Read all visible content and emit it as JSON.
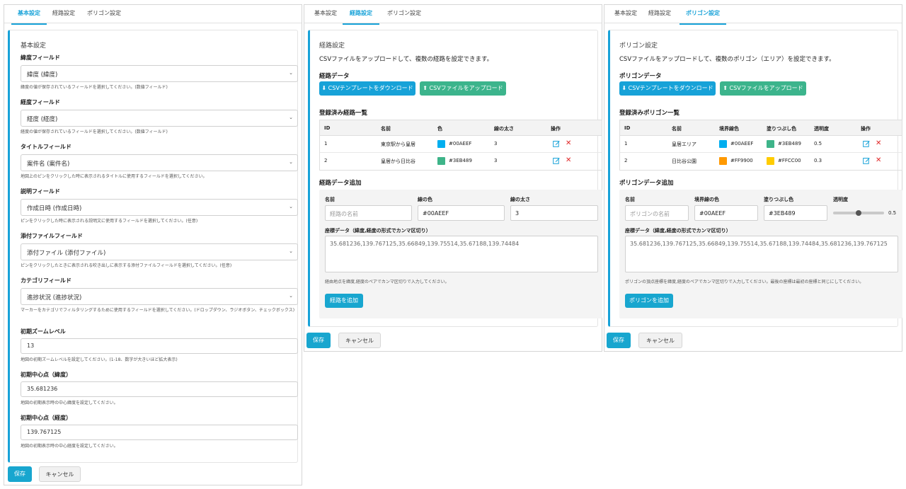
{
  "panel1": {
    "tabs": [
      "基本設定",
      "経路設定",
      "ポリゴン設定"
    ],
    "card_title": "基本設定",
    "fields": [
      {
        "label": "緯度フィールド",
        "value": "緯度 (緯度)",
        "help": "緯度の値が保存されているフィールドを選択してください。(数値フィールド)"
      },
      {
        "label": "経度フィールド",
        "value": "経度 (経度)",
        "help": "経度の値が保存されているフィールドを選択してください。(数値フィールド)"
      },
      {
        "label": "タイトルフィールド",
        "value": "案件名 (案件名)",
        "help": "地図上のピンをクリックした時に表示されるタイトルに使用するフィールドを選択してください。"
      },
      {
        "label": "説明フィールド",
        "value": "作成日時 (作成日時)",
        "help": "ピンをクリックした時に表示される説明文に使用するフィールドを選択してください。(任意)"
      },
      {
        "label": "添付ファイルフィールド",
        "value": "添付ファイル (添付ファイル)",
        "help": "ピンをクリックしたときに表示される吹き出しに表示する添付ファイルフィールドを選択してください。(任意)"
      },
      {
        "label": "カテゴリフィールド",
        "value": "進捗状況 (進捗状況)",
        "help": "マーカーをカテゴリでフィルタリングするために使用するフィールドを選択してください。(ドロップダウン、ラジオボタン、チェックボックス)"
      }
    ],
    "zoom": {
      "label": "初期ズームレベル",
      "value": "13",
      "help": "地図の初期ズームレベルを設定してください。(1-18、数字が大きいほど拡大表示)"
    },
    "center_lat": {
      "label": "初期中心点（緯度）",
      "value": "35.681236",
      "help": "地図の初期表示時の中心緯度を設定してください。"
    },
    "center_lng": {
      "label": "初期中心点（経度）",
      "value": "139.767125",
      "help": "地図の初期表示時の中心経度を設定してください。"
    },
    "save": "保存",
    "cancel": "キャンセル"
  },
  "panel2": {
    "tabs": [
      "基本設定",
      "経路設定",
      "ポリゴン設定"
    ],
    "card_title": "経路設定",
    "description": "CSVファイルをアップロードして、複数の経路を設定できます。",
    "data_section": "経路データ",
    "download_btn": "CSVテンプレートをダウンロード",
    "upload_btn": "CSVファイルをアップロード",
    "list_title": "登録済み経路一覧",
    "columns": [
      "ID",
      "名前",
      "色",
      "線の太さ",
      "操作"
    ],
    "rows": [
      {
        "id": "1",
        "name": "東京駅から皇居",
        "color": "#00AEEF",
        "width": "3"
      },
      {
        "id": "2",
        "name": "皇居から日比谷",
        "color": "#3EB489",
        "width": "3"
      }
    ],
    "add_title": "経路データ追加",
    "form": {
      "name_label": "名前",
      "name_placeholder": "経路の名前",
      "color_label": "線の色",
      "color_value": "#00AEEF",
      "width_label": "線の太さ",
      "width_value": "3",
      "coords_label": "座標データ（緯度,経度の形式でカンマ区切り）",
      "coords_value": "35.681236,139.767125,35.66849,139.75514,35.67188,139.74484",
      "coords_help": "経由地点を緯度,経度のペアでカンマ区切りで入力してください。",
      "add_btn": "経路を追加"
    },
    "save": "保存",
    "cancel": "キャンセル"
  },
  "panel3": {
    "tabs": [
      "基本設定",
      "経路設定",
      "ポリゴン設定"
    ],
    "card_title": "ポリゴン設定",
    "description": "CSVファイルをアップロードして、複数のポリゴン（エリア）を設定できます。",
    "data_section": "ポリゴンデータ",
    "download_btn": "CSVテンプレートをダウンロード",
    "upload_btn": "CSVファイルをアップロード",
    "list_title": "登録済みポリゴン一覧",
    "columns": [
      "ID",
      "名前",
      "境界線色",
      "塗りつぶし色",
      "透明度",
      "操作"
    ],
    "rows": [
      {
        "id": "1",
        "name": "皇居エリア",
        "border": "#00AEEF",
        "fill": "#3EB489",
        "opacity": "0.5"
      },
      {
        "id": "2",
        "name": "日比谷公園",
        "border": "#FF9900",
        "fill": "#FFCC00",
        "opacity": "0.3"
      }
    ],
    "add_title": "ポリゴンデータ追加",
    "form": {
      "name_label": "名前",
      "name_placeholder": "ポリゴンの名前",
      "border_label": "境界線の色",
      "border_value": "#00AEEF",
      "fill_label": "塗りつぶし色",
      "fill_value": "#3EB489",
      "opacity_label": "透明度",
      "opacity_value": "0.5",
      "coords_label": "座標データ（緯度,経度の形式でカンマ区切り）",
      "coords_value": "35.681236,139.767125,35.66849,139.75514,35.67188,139.74484,35.681236,139.767125",
      "coords_help": "ポリゴンの頂点座標を緯度,経度のペアでカンマ区切りで入力してください。最後の座標は最初の座標と同じにしてください。",
      "add_btn": "ポリゴンを追加"
    },
    "save": "保存",
    "cancel": "キャンセル"
  },
  "colors": {
    "accent": "#17a2d8",
    "success": "#3cb48c",
    "danger": "#e02424"
  },
  "icons": {
    "download": "download-icon",
    "upload": "upload-icon",
    "edit": "edit-icon",
    "delete": "delete-icon",
    "dropdown": "chevron-down-icon"
  }
}
